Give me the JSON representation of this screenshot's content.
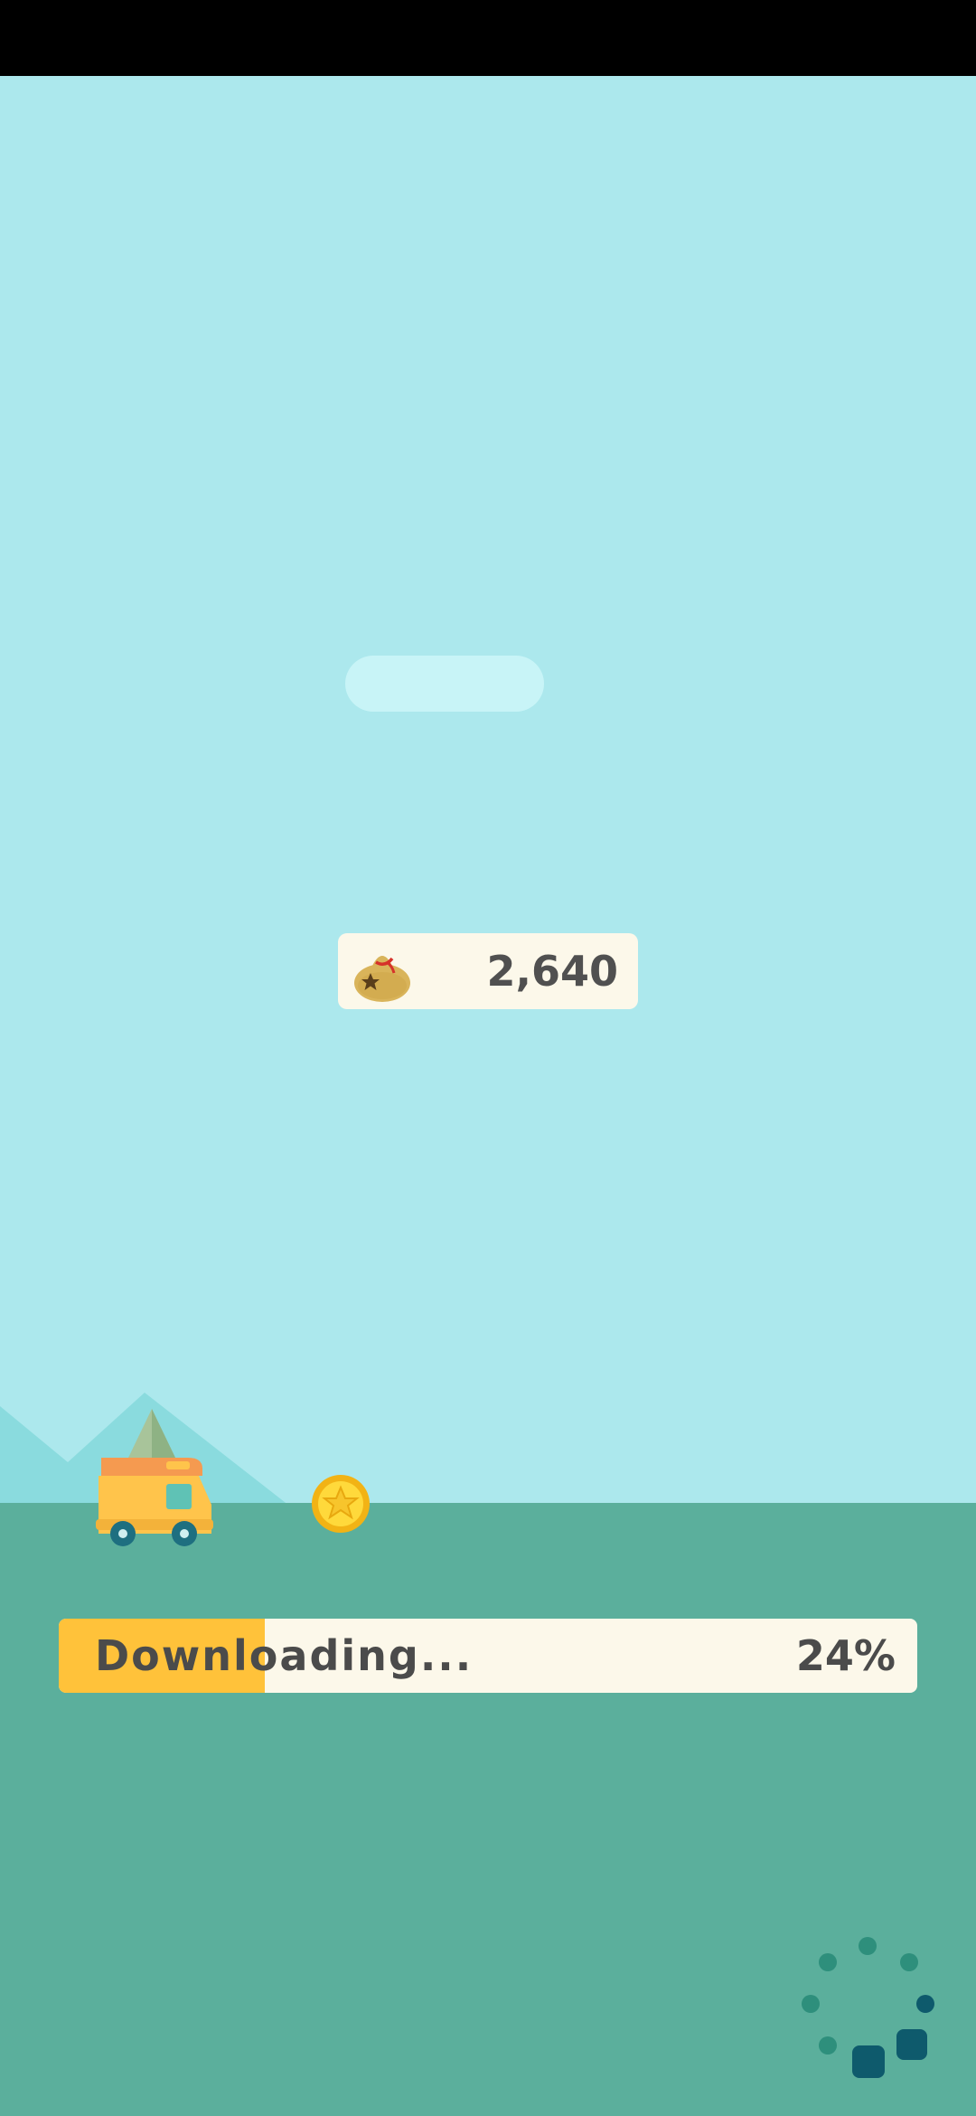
{
  "currency": {
    "icon": "money-bag-icon",
    "value": "2,640"
  },
  "download": {
    "label": "Downloading...",
    "percent_text": "24%",
    "progress": 0.24
  },
  "icons": {
    "camper": "camper-van-icon",
    "coin": "star-coin-icon",
    "spinner": "loading-spinner-icon"
  },
  "colors": {
    "sky": "#ACE8ED",
    "ground": "#5BAF9C",
    "progress_fill": "#FFC23A",
    "card": "#FCF8EA"
  }
}
